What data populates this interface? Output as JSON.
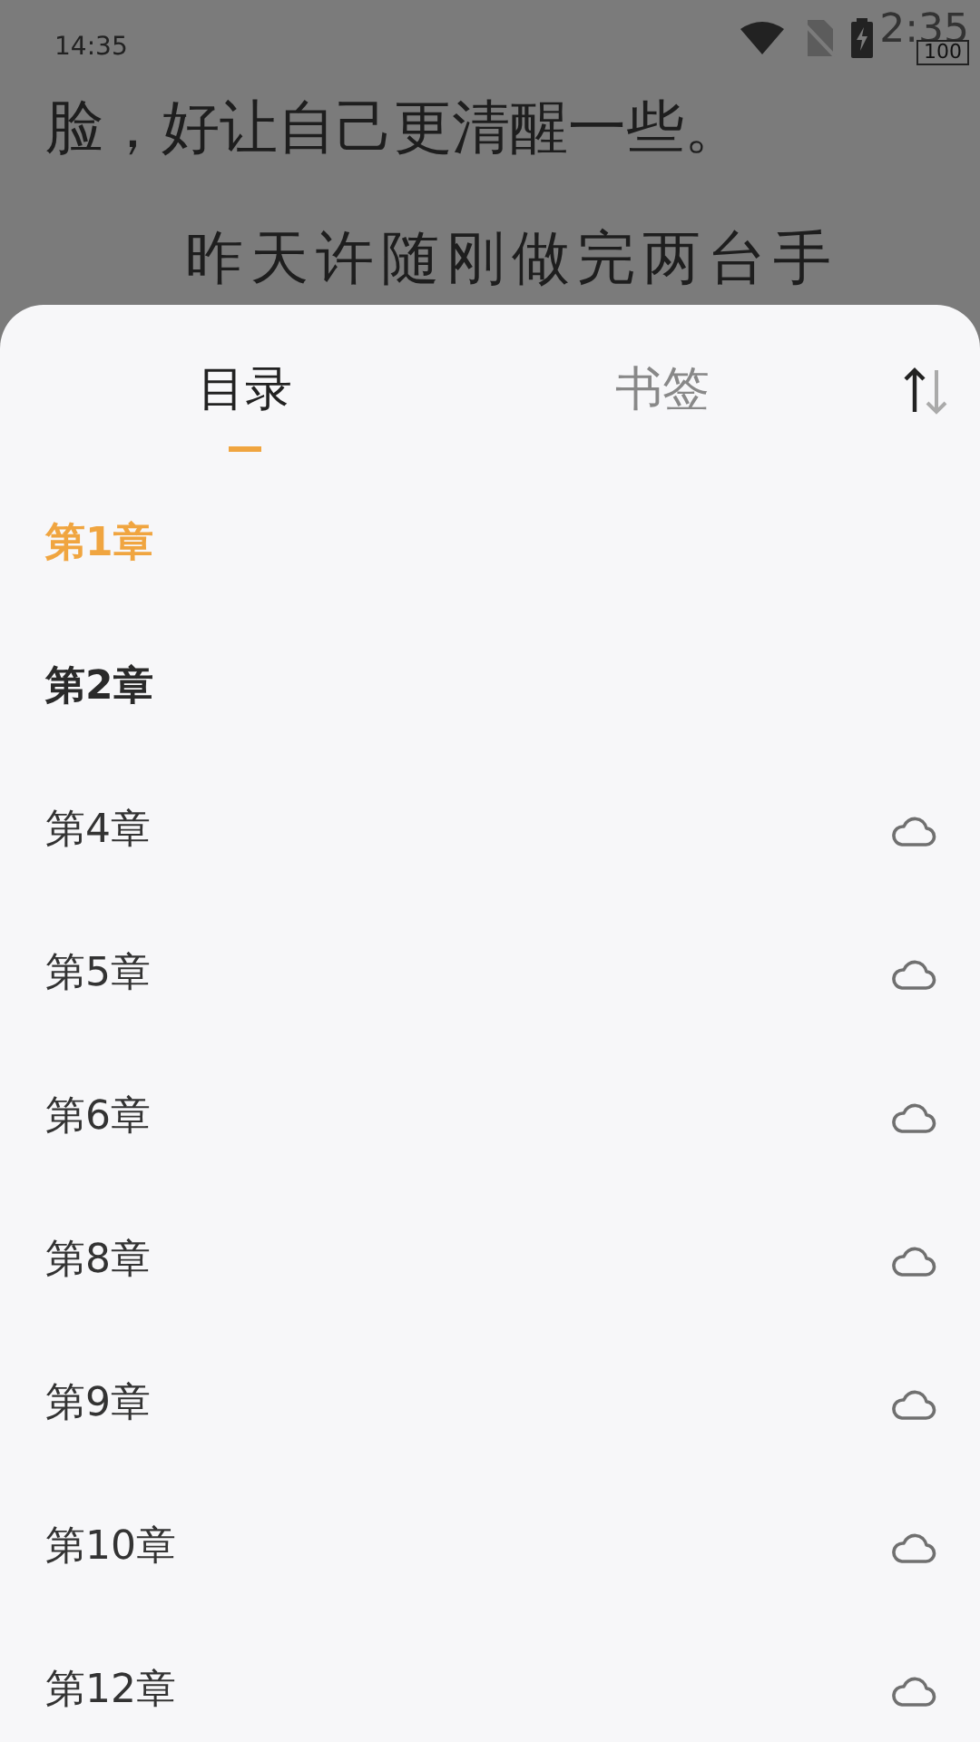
{
  "status_bar": {
    "time": "14:35",
    "clock_overlay": "2:35",
    "battery": "100"
  },
  "reading_text": [
    "脸，好让自己更清醒一些。",
    "昨天许随刚做完两台手"
  ],
  "tabs": [
    {
      "label": "目录",
      "selected": true
    },
    {
      "label": "书签",
      "selected": false
    }
  ],
  "chapters": [
    {
      "title": "第1章",
      "selected": true,
      "downloaded": true
    },
    {
      "title": "第2章",
      "selected": false,
      "downloaded": true
    },
    {
      "title": "第4章",
      "selected": false,
      "downloaded": false
    },
    {
      "title": "第5章",
      "selected": false,
      "downloaded": false
    },
    {
      "title": "第6章",
      "selected": false,
      "downloaded": false
    },
    {
      "title": "第8章",
      "selected": false,
      "downloaded": false
    },
    {
      "title": "第9章",
      "selected": false,
      "downloaded": false
    },
    {
      "title": "第10章",
      "selected": false,
      "downloaded": false
    },
    {
      "title": "第12章",
      "selected": false,
      "downloaded": false
    }
  ]
}
